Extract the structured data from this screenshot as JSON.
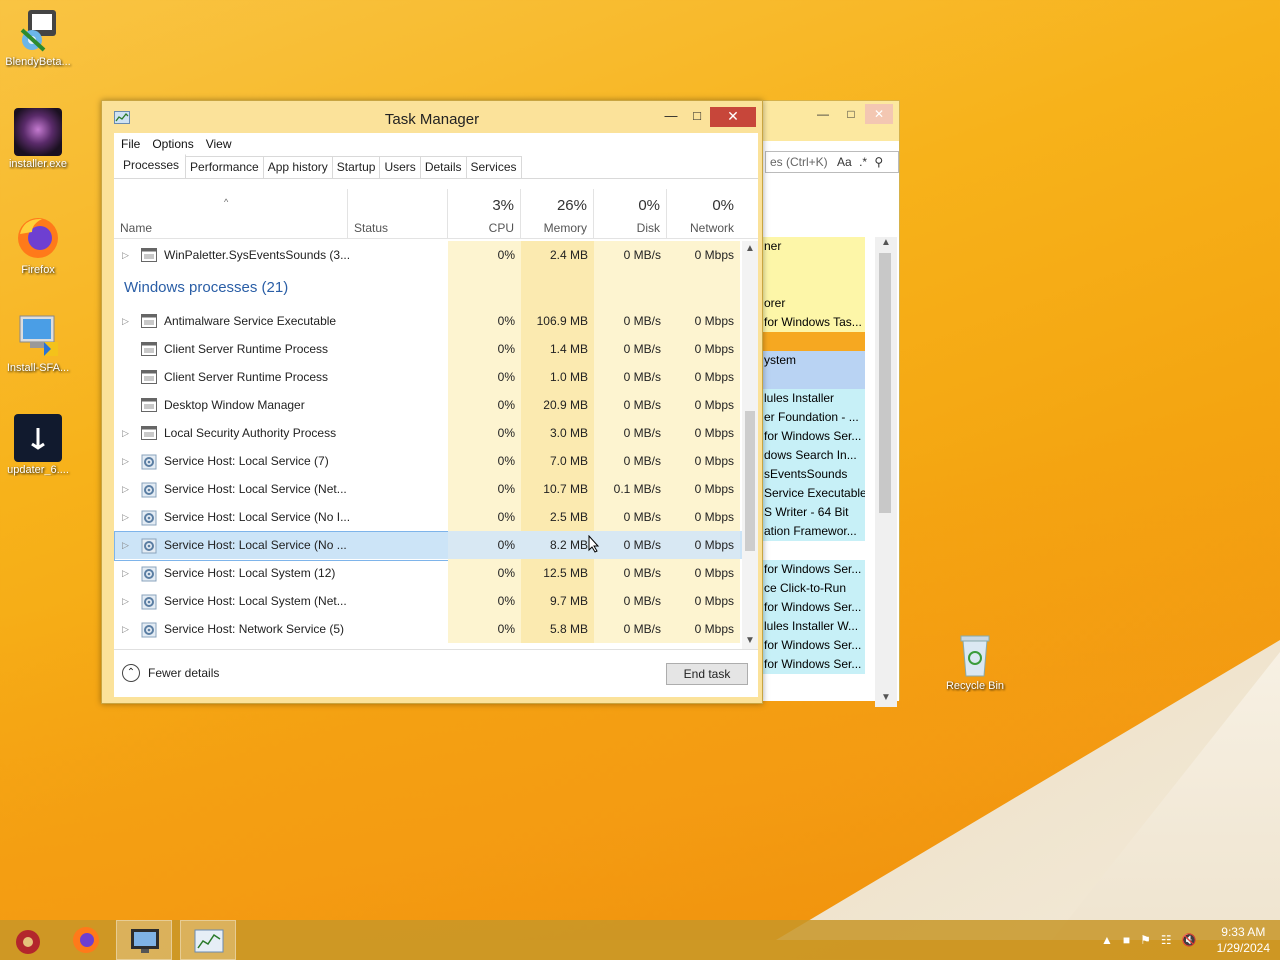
{
  "desktop": {
    "icons": [
      {
        "label": "BlendyBeta...",
        "icon": "installer-icon"
      },
      {
        "label": "installer.exe",
        "icon": "app-icon"
      },
      {
        "label": "Firefox",
        "icon": "firefox-icon"
      },
      {
        "label": "Install-SFA...",
        "icon": "setup-icon"
      },
      {
        "label": "updater_6....",
        "icon": "updater-icon"
      },
      {
        "label": "Recycle Bin",
        "icon": "recycle-bin-icon"
      }
    ]
  },
  "bgwindow": {
    "search_text": "es (Ctrl+K)",
    "search_suffix": "Aa",
    "list": [
      {
        "text": "ner",
        "color": "#fdf6a8"
      },
      {
        "text": "",
        "color": "#fdf6a8"
      },
      {
        "text": "",
        "color": "#fdf6a8"
      },
      {
        "text": "orer",
        "color": "#fdf6a8"
      },
      {
        "text": "for Windows Tas...",
        "color": "#fdf6a8"
      },
      {
        "text": "",
        "color": "#f6a821"
      },
      {
        "text": "ystem",
        "color": "#b9d3f3"
      },
      {
        "text": "",
        "color": "#b9d3f3"
      },
      {
        "text": "lules Installer",
        "color": "#c7f0f7"
      },
      {
        "text": "er Foundation - ...",
        "color": "#c7f0f7"
      },
      {
        "text": "for Windows Ser...",
        "color": "#c7f0f7"
      },
      {
        "text": "dows Search In...",
        "color": "#c7f0f7"
      },
      {
        "text": "sEventsSounds",
        "color": "#c7f0f7"
      },
      {
        "text": "Service Executable",
        "color": "#c7f0f7"
      },
      {
        "text": "S Writer - 64 Bit",
        "color": "#c7f0f7"
      },
      {
        "text": "ation Framewor...",
        "color": "#c7f0f7"
      },
      {
        "text": "",
        "color": "#ffffff"
      },
      {
        "text": "for Windows Ser...",
        "color": "#c7f0f7"
      },
      {
        "text": "ce Click-to-Run",
        "color": "#c7f0f7"
      },
      {
        "text": "for Windows Ser...",
        "color": "#c7f0f7"
      },
      {
        "text": "lules Installer W...",
        "color": "#c7f0f7"
      },
      {
        "text": "for Windows Ser...",
        "color": "#c7f0f7"
      },
      {
        "text": "for Windows Ser...",
        "color": "#c7f0f7"
      }
    ]
  },
  "taskmanager": {
    "title": "Task Manager",
    "menu": [
      "File",
      "Options",
      "View"
    ],
    "tabs": [
      "Processes",
      "Performance",
      "App history",
      "Startup",
      "Users",
      "Details",
      "Services"
    ],
    "active_tab": "Processes",
    "columns": {
      "name": "Name",
      "status": "Status",
      "cpu": {
        "pct": "3%",
        "label": "CPU"
      },
      "memory": {
        "pct": "26%",
        "label": "Memory"
      },
      "disk": {
        "pct": "0%",
        "label": "Disk"
      },
      "network": {
        "pct": "0%",
        "label": "Network"
      }
    },
    "rows": [
      {
        "type": "process",
        "expand": true,
        "icon": "window",
        "name": "WinPaletter.SysEventsSounds (3...",
        "cpu": "0%",
        "mem": "2.4 MB",
        "disk": "0 MB/s",
        "net": "0 Mbps"
      },
      {
        "type": "group",
        "name": "Windows processes (21)"
      },
      {
        "type": "process",
        "expand": true,
        "icon": "window",
        "name": "Antimalware Service Executable",
        "cpu": "0%",
        "mem": "106.9 MB",
        "disk": "0 MB/s",
        "net": "0 Mbps"
      },
      {
        "type": "process",
        "expand": false,
        "icon": "window",
        "name": "Client Server Runtime Process",
        "cpu": "0%",
        "mem": "1.4 MB",
        "disk": "0 MB/s",
        "net": "0 Mbps"
      },
      {
        "type": "process",
        "expand": false,
        "icon": "window",
        "name": "Client Server Runtime Process",
        "cpu": "0%",
        "mem": "1.0 MB",
        "disk": "0 MB/s",
        "net": "0 Mbps"
      },
      {
        "type": "process",
        "expand": false,
        "icon": "window",
        "name": "Desktop Window Manager",
        "cpu": "0%",
        "mem": "20.9 MB",
        "disk": "0 MB/s",
        "net": "0 Mbps"
      },
      {
        "type": "process",
        "expand": true,
        "icon": "window",
        "name": "Local Security Authority Process",
        "cpu": "0%",
        "mem": "3.0 MB",
        "disk": "0 MB/s",
        "net": "0 Mbps"
      },
      {
        "type": "process",
        "expand": true,
        "icon": "gear",
        "name": "Service Host: Local Service (7)",
        "cpu": "0%",
        "mem": "7.0 MB",
        "disk": "0 MB/s",
        "net": "0 Mbps"
      },
      {
        "type": "process",
        "expand": true,
        "icon": "gear",
        "name": "Service Host: Local Service (Net...",
        "cpu": "0%",
        "mem": "10.7 MB",
        "disk": "0.1 MB/s",
        "net": "0 Mbps"
      },
      {
        "type": "process",
        "expand": true,
        "icon": "gear",
        "name": "Service Host: Local Service (No I...",
        "cpu": "0%",
        "mem": "2.5 MB",
        "disk": "0 MB/s",
        "net": "0 Mbps"
      },
      {
        "type": "process",
        "expand": true,
        "icon": "gear",
        "name": "Service Host: Local Service (No ...",
        "cpu": "0%",
        "mem": "8.2 MB",
        "disk": "0 MB/s",
        "net": "0 Mbps",
        "selected": true
      },
      {
        "type": "process",
        "expand": true,
        "icon": "gear",
        "name": "Service Host: Local System (12)",
        "cpu": "0%",
        "mem": "12.5 MB",
        "disk": "0 MB/s",
        "net": "0 Mbps"
      },
      {
        "type": "process",
        "expand": true,
        "icon": "gear",
        "name": "Service Host: Local System (Net...",
        "cpu": "0%",
        "mem": "9.7 MB",
        "disk": "0 MB/s",
        "net": "0 Mbps"
      },
      {
        "type": "process",
        "expand": true,
        "icon": "gear",
        "name": "Service Host: Network Service (5)",
        "cpu": "0%",
        "mem": "5.8 MB",
        "disk": "0 MB/s",
        "net": "0 Mbps"
      }
    ],
    "footer": {
      "fewer_details": "Fewer details",
      "end_task": "End task"
    }
  },
  "taskbar": {
    "items": [
      "app-icon",
      "firefox-icon",
      "remote-desktop-icon",
      "task-manager-icon"
    ],
    "time": "9:33 AM",
    "date": "1/29/2024"
  },
  "colors": {
    "accent_orange": "#f7b21a",
    "selection_blue": "#cce4f7",
    "close_red": "#c7463a",
    "group_blue": "#2a5ea6"
  }
}
